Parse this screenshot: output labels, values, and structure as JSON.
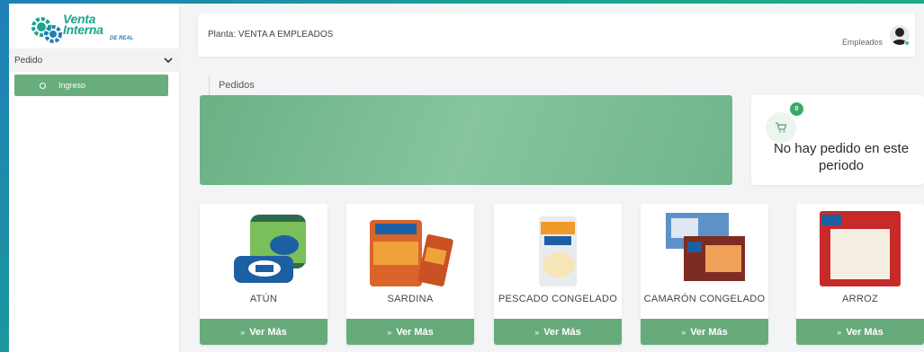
{
  "sidebar": {
    "logo": {
      "line1": "Venta",
      "line2": "Interna",
      "sub": "DE REAL"
    },
    "menu_header": "Pedido",
    "items": [
      {
        "label": "Ingreso",
        "active": true
      }
    ]
  },
  "topbar": {
    "planta": "Planta: VENTA A EMPLEADOS",
    "user": "Empleados"
  },
  "main": {
    "page_title": "Pedidos",
    "cart": {
      "badge": "0",
      "message": "No hay pedido en este periodo"
    },
    "products": [
      {
        "name": "ATÚN",
        "button": "Ver Más"
      },
      {
        "name": "SARDINA",
        "button": "Ver Más"
      },
      {
        "name": "PESCADO CONGELADO",
        "button": "Ver Más"
      },
      {
        "name": "CAMARÓN CONGELADO",
        "button": "Ver Más"
      },
      {
        "name": "ARROZ",
        "button": "Ver Más"
      }
    ]
  },
  "colors": {
    "accent": "#67ab7b",
    "banner": "#7ab994",
    "brand_teal": "#1aa58f",
    "brand_blue": "#1f7fb8"
  },
  "icons": [
    "gear-logo-icon",
    "chevron-down-icon",
    "circle-icon",
    "avatar-icon",
    "cart-icon",
    "double-chevron-right-icon"
  ]
}
